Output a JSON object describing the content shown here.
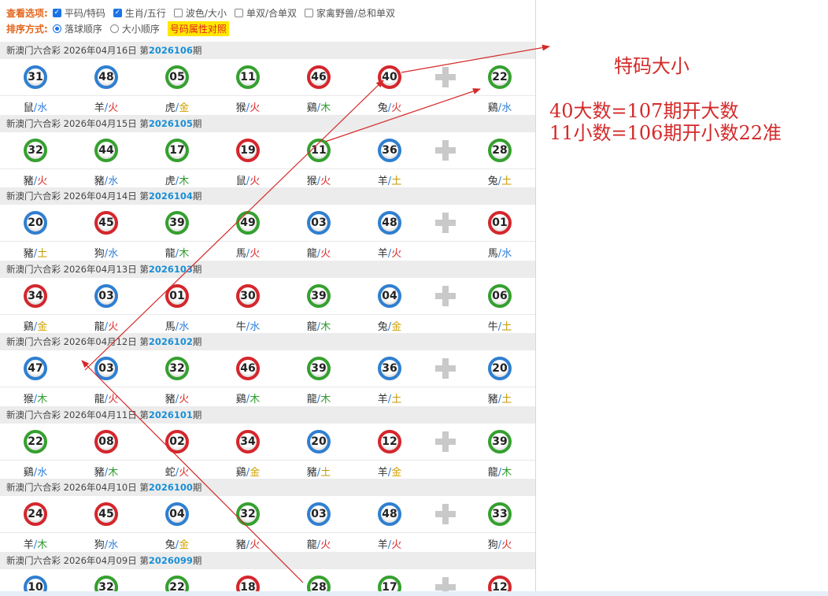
{
  "options": {
    "view_label": "查看选项:",
    "view_items": [
      {
        "label": "平码/特码",
        "checked": true
      },
      {
        "label": "生肖/五行",
        "checked": true
      },
      {
        "label": "波色/大小",
        "checked": false
      },
      {
        "label": "单双/合单双",
        "checked": false
      },
      {
        "label": "家禽野兽/总和单双",
        "checked": false
      }
    ],
    "sort_label": "排序方式:",
    "sort_items": [
      {
        "label": "落球顺序",
        "selected": true
      },
      {
        "label": "大小顺序",
        "selected": false
      }
    ],
    "compare_button": "号码属性对照"
  },
  "draws": [
    {
      "prefix": "新澳门六合彩 2026年04月16日 第",
      "issue": "2026106",
      "suffix": "期",
      "balls": [
        {
          "num": "31",
          "color": "blue",
          "zodiac": "鼠",
          "element": "水",
          "el": "water"
        },
        {
          "num": "48",
          "color": "blue",
          "zodiac": "羊",
          "element": "火",
          "el": "fire"
        },
        {
          "num": "05",
          "color": "green",
          "zodiac": "虎",
          "element": "金",
          "el": "gold"
        },
        {
          "num": "11",
          "color": "green",
          "zodiac": "猴",
          "element": "火",
          "el": "fire"
        },
        {
          "num": "46",
          "color": "red",
          "zodiac": "鷄",
          "element": "木",
          "el": "wood"
        },
        {
          "num": "40",
          "color": "red",
          "zodiac": "兔",
          "element": "火",
          "el": "fire"
        },
        {
          "num": "22",
          "color": "green",
          "zodiac": "鷄",
          "element": "水",
          "el": "water"
        }
      ]
    },
    {
      "prefix": "新澳门六合彩 2026年04月15日 第",
      "issue": "2026105",
      "suffix": "期",
      "balls": [
        {
          "num": "32",
          "color": "green",
          "zodiac": "豬",
          "element": "火",
          "el": "fire"
        },
        {
          "num": "44",
          "color": "green",
          "zodiac": "豬",
          "element": "水",
          "el": "water"
        },
        {
          "num": "17",
          "color": "green",
          "zodiac": "虎",
          "element": "木",
          "el": "wood"
        },
        {
          "num": "19",
          "color": "red",
          "zodiac": "鼠",
          "element": "火",
          "el": "fire"
        },
        {
          "num": "11",
          "color": "green",
          "zodiac": "猴",
          "element": "火",
          "el": "fire"
        },
        {
          "num": "36",
          "color": "blue",
          "zodiac": "羊",
          "element": "土",
          "el": "earth"
        },
        {
          "num": "28",
          "color": "green",
          "zodiac": "兔",
          "element": "土",
          "el": "earth"
        }
      ]
    },
    {
      "prefix": "新澳门六合彩 2026年04月14日 第",
      "issue": "2026104",
      "suffix": "期",
      "balls": [
        {
          "num": "20",
          "color": "blue",
          "zodiac": "豬",
          "element": "土",
          "el": "earth"
        },
        {
          "num": "45",
          "color": "red",
          "zodiac": "狗",
          "element": "水",
          "el": "water"
        },
        {
          "num": "39",
          "color": "green",
          "zodiac": "龍",
          "element": "木",
          "el": "wood"
        },
        {
          "num": "49",
          "color": "green",
          "zodiac": "馬",
          "element": "火",
          "el": "fire"
        },
        {
          "num": "03",
          "color": "blue",
          "zodiac": "龍",
          "element": "火",
          "el": "fire"
        },
        {
          "num": "48",
          "color": "blue",
          "zodiac": "羊",
          "element": "火",
          "el": "fire"
        },
        {
          "num": "01",
          "color": "red",
          "zodiac": "馬",
          "element": "水",
          "el": "water"
        }
      ]
    },
    {
      "prefix": "新澳门六合彩 2026年04月13日 第",
      "issue": "2026103",
      "suffix": "期",
      "balls": [
        {
          "num": "34",
          "color": "red",
          "zodiac": "鷄",
          "element": "金",
          "el": "gold"
        },
        {
          "num": "03",
          "color": "blue",
          "zodiac": "龍",
          "element": "火",
          "el": "fire"
        },
        {
          "num": "01",
          "color": "red",
          "zodiac": "馬",
          "element": "水",
          "el": "water"
        },
        {
          "num": "30",
          "color": "red",
          "zodiac": "牛",
          "element": "水",
          "el": "water"
        },
        {
          "num": "39",
          "color": "green",
          "zodiac": "龍",
          "element": "木",
          "el": "wood"
        },
        {
          "num": "04",
          "color": "blue",
          "zodiac": "兔",
          "element": "金",
          "el": "gold"
        },
        {
          "num": "06",
          "color": "green",
          "zodiac": "牛",
          "element": "土",
          "el": "earth"
        }
      ]
    },
    {
      "prefix": "新澳门六合彩 2026年04月12日 第",
      "issue": "2026102",
      "suffix": "期",
      "balls": [
        {
          "num": "47",
          "color": "blue",
          "zodiac": "猴",
          "element": "木",
          "el": "wood"
        },
        {
          "num": "03",
          "color": "blue",
          "zodiac": "龍",
          "element": "火",
          "el": "fire"
        },
        {
          "num": "32",
          "color": "green",
          "zodiac": "豬",
          "element": "火",
          "el": "fire"
        },
        {
          "num": "46",
          "color": "red",
          "zodiac": "鷄",
          "element": "木",
          "el": "wood"
        },
        {
          "num": "39",
          "color": "green",
          "zodiac": "龍",
          "element": "木",
          "el": "wood"
        },
        {
          "num": "36",
          "color": "blue",
          "zodiac": "羊",
          "element": "土",
          "el": "earth"
        },
        {
          "num": "20",
          "color": "blue",
          "zodiac": "豬",
          "element": "土",
          "el": "earth"
        }
      ]
    },
    {
      "prefix": "新澳门六合彩 2026年04月11日 第",
      "issue": "2026101",
      "suffix": "期",
      "balls": [
        {
          "num": "22",
          "color": "green",
          "zodiac": "鷄",
          "element": "水",
          "el": "water"
        },
        {
          "num": "08",
          "color": "red",
          "zodiac": "豬",
          "element": "木",
          "el": "wood"
        },
        {
          "num": "02",
          "color": "red",
          "zodiac": "蛇",
          "element": "火",
          "el": "fire"
        },
        {
          "num": "34",
          "color": "red",
          "zodiac": "鷄",
          "element": "金",
          "el": "gold"
        },
        {
          "num": "20",
          "color": "blue",
          "zodiac": "豬",
          "element": "土",
          "el": "earth"
        },
        {
          "num": "12",
          "color": "red",
          "zodiac": "羊",
          "element": "金",
          "el": "gold"
        },
        {
          "num": "39",
          "color": "green",
          "zodiac": "龍",
          "element": "木",
          "el": "wood"
        }
      ]
    },
    {
      "prefix": "新澳门六合彩 2026年04月10日 第",
      "issue": "2026100",
      "suffix": "期",
      "balls": [
        {
          "num": "24",
          "color": "red",
          "zodiac": "羊",
          "element": "木",
          "el": "wood"
        },
        {
          "num": "45",
          "color": "red",
          "zodiac": "狗",
          "element": "水",
          "el": "water"
        },
        {
          "num": "04",
          "color": "blue",
          "zodiac": "兔",
          "element": "金",
          "el": "gold"
        },
        {
          "num": "32",
          "color": "green",
          "zodiac": "豬",
          "element": "火",
          "el": "fire"
        },
        {
          "num": "03",
          "color": "blue",
          "zodiac": "龍",
          "element": "火",
          "el": "fire"
        },
        {
          "num": "48",
          "color": "blue",
          "zodiac": "羊",
          "element": "火",
          "el": "fire"
        },
        {
          "num": "33",
          "color": "green",
          "zodiac": "狗",
          "element": "火",
          "el": "fire"
        }
      ]
    },
    {
      "prefix": "新澳门六合彩 2026年04月09日 第",
      "issue": "2026099",
      "suffix": "期",
      "balls": [
        {
          "num": "10",
          "color": "blue",
          "zodiac": "",
          "element": "",
          "el": "water"
        },
        {
          "num": "32",
          "color": "green",
          "zodiac": "",
          "element": "",
          "el": "water"
        },
        {
          "num": "22",
          "color": "green",
          "zodiac": "",
          "element": "",
          "el": "water"
        },
        {
          "num": "18",
          "color": "red",
          "zodiac": "",
          "element": "",
          "el": "water"
        },
        {
          "num": "28",
          "color": "green",
          "zodiac": "",
          "element": "",
          "el": "water"
        },
        {
          "num": "17",
          "color": "green",
          "zodiac": "",
          "element": "",
          "el": "water"
        },
        {
          "num": "12",
          "color": "red",
          "zodiac": "",
          "element": "",
          "el": "water"
        }
      ]
    }
  ],
  "annotation": {
    "title": "特码大小",
    "line1": "40大数=107期开大数",
    "line2": "11小数=106期开小数22准",
    "color": "#d42a2a"
  }
}
